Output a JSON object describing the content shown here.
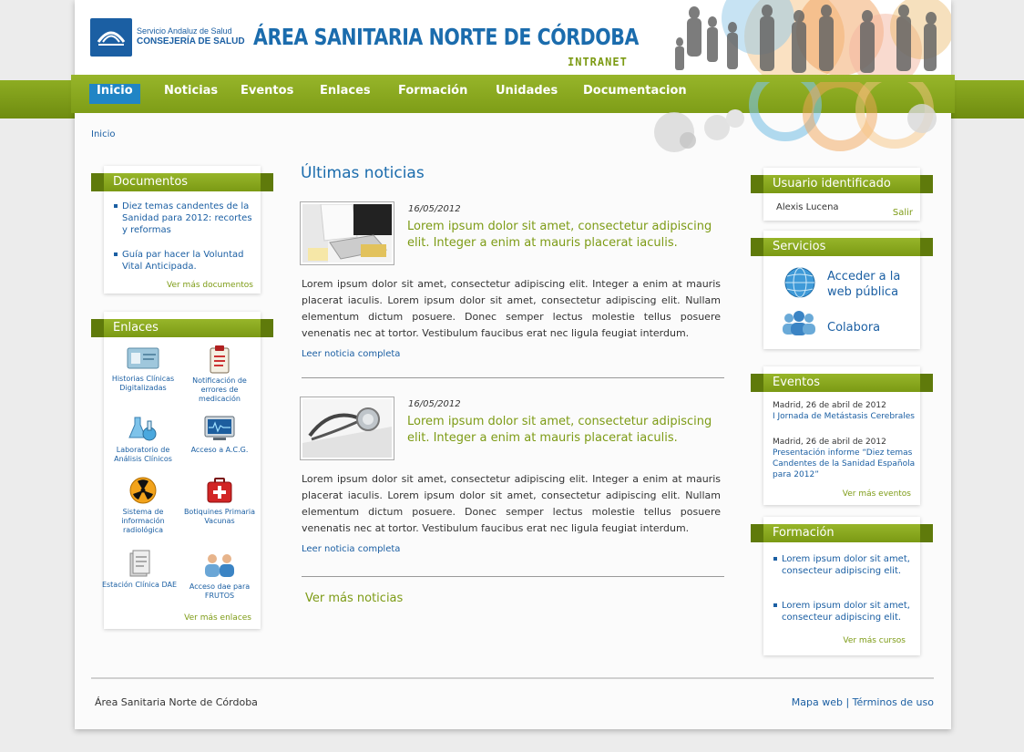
{
  "header": {
    "logo_line1": "Servicio Andaluz de Salud",
    "logo_line2": "CONSEJERÍA DE SALUD",
    "title": "ÁREA SANITARIA NORTE DE CÓRDOBA",
    "subtitle": "INTRANET"
  },
  "nav": {
    "items": [
      {
        "label": "Inicio",
        "active": true
      },
      {
        "label": "Noticias"
      },
      {
        "label": "Eventos"
      },
      {
        "label": "Enlaces"
      },
      {
        "label": "Formación"
      },
      {
        "label": "Unidades"
      },
      {
        "label": "Documentacion"
      }
    ]
  },
  "breadcrumb": "Inicio",
  "documentos": {
    "title": "Documentos",
    "items": [
      "Diez temas candentes de la Sanidad para 2012: recortes y reformas",
      "Guía par hacer la Voluntad Vital Anticipada."
    ],
    "more": "Ver más documentos"
  },
  "enlaces": {
    "title": "Enlaces",
    "items": [
      {
        "label": "Historias Clínicas Digitalizadas",
        "icon": "id-card-icon"
      },
      {
        "label": "Notificación de errores de medicación",
        "icon": "clipboard-icon"
      },
      {
        "label": "Laboratorio de Análisis Clínicos",
        "icon": "flask-icon"
      },
      {
        "label": "Acceso a A.C.G.",
        "icon": "monitor-icon"
      },
      {
        "label": "Sistema de información radiológica",
        "icon": "radiation-icon"
      },
      {
        "label": "Botiquines Primaria Vacunas",
        "icon": "first-aid-icon"
      },
      {
        "label": "Estación Clínica DAE",
        "icon": "document-icon"
      },
      {
        "label": "Acceso dae para FRUTOS",
        "icon": "users-icon"
      }
    ],
    "more": "Ver más enlaces"
  },
  "news": {
    "heading": "Últimas noticias",
    "items": [
      {
        "date": "16/05/2012",
        "title": "Lorem ipsum dolor sit amet, consectetur adipiscing elit. Integer a enim at mauris placerat iaculis.",
        "body": "Lorem ipsum dolor sit amet, consectetur adipiscing elit. Integer a enim at mauris placerat iaculis. Lorem ipsum dolor sit amet, consectetur adipiscing elit. Nullam elementum dictum posuere. Donec semper lectus molestie tellus posuere venenatis nec at tortor. Vestibulum faucibus erat nec ligula feugiat interdum.",
        "link": "Leer noticia completa"
      },
      {
        "date": "16/05/2012",
        "title": "Lorem ipsum dolor sit amet, consectetur adipiscing elit. Integer a enim at mauris placerat iaculis.",
        "body": "Lorem ipsum dolor sit amet, consectetur adipiscing elit. Integer a enim at mauris placerat iaculis. Lorem ipsum dolor sit amet, consectetur adipiscing elit. Nullam elementum dictum posuere. Donec semper lectus molestie tellus posuere venenatis nec at tortor. Vestibulum faucibus erat nec ligula feugiat interdum.",
        "link": "Leer noticia completa"
      }
    ],
    "more": "Ver más noticias"
  },
  "usuario": {
    "title": "Usuario identificado",
    "name": "Alexis Lucena",
    "logout": "Salir"
  },
  "servicios": {
    "title": "Servicios",
    "items": [
      {
        "label": "Acceder a la web pública",
        "icon": "globe-icon"
      },
      {
        "label": "Colabora",
        "icon": "people-icon"
      }
    ]
  },
  "eventos": {
    "title": "Eventos",
    "items": [
      {
        "date": "Madrid, 26 de abril de 2012",
        "title": "I Jornada de Metástasis Cerebrales"
      },
      {
        "date": "Madrid, 26 de abril de 2012",
        "title": "Presentación informe “Diez temas Candentes de la Sanidad Española para 2012”"
      }
    ],
    "more": "Ver más eventos"
  },
  "formacion": {
    "title": "Formación",
    "items": [
      "Lorem ipsum dolor sit amet, consecteur adipiscing elit.",
      "Lorem ipsum dolor sit amet, consecteur adipiscing elit."
    ],
    "more": "Ver más cursos"
  },
  "footer": {
    "left": "Área Sanitaria Norte de Córdoba",
    "right": "Mapa web | Términos de uso"
  },
  "colors": {
    "brand_green": "#7d9b15",
    "brand_blue": "#1b6cad",
    "nav_active": "#2185c5"
  }
}
